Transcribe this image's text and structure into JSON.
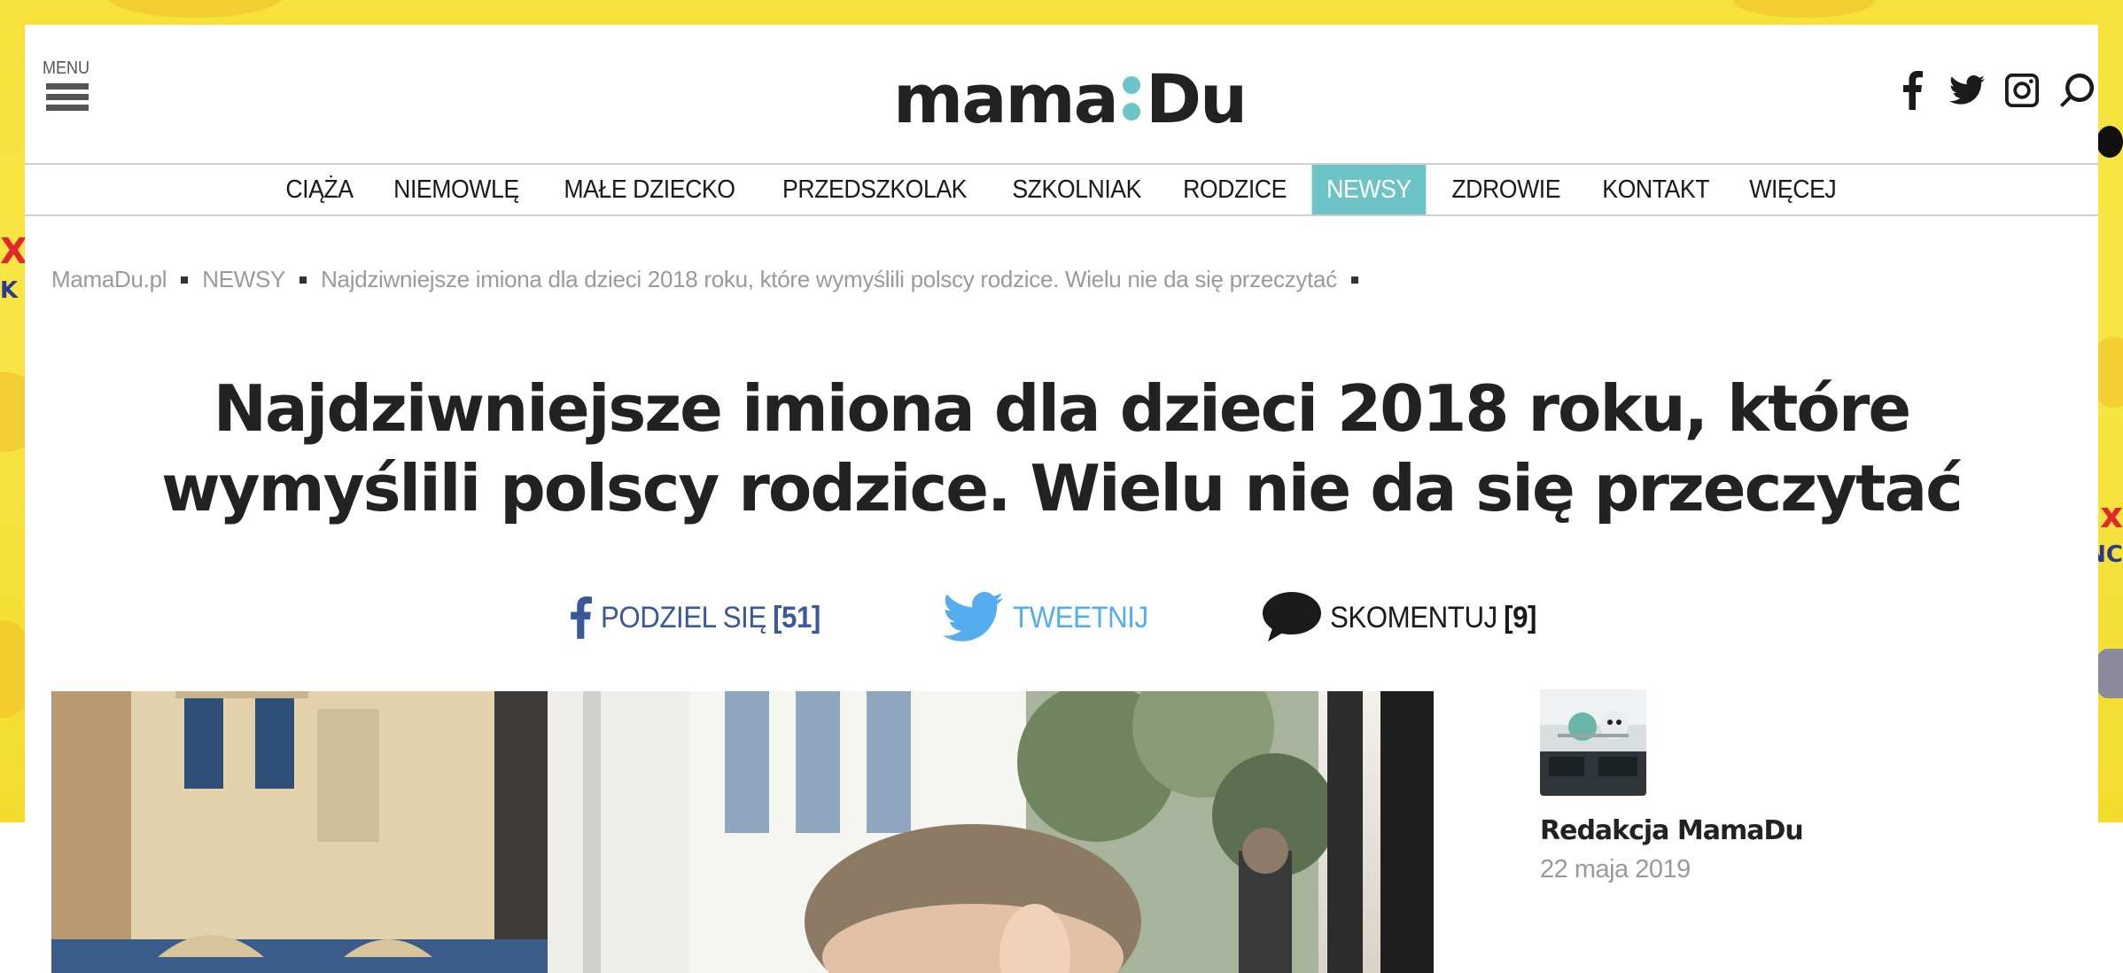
{
  "header": {
    "menu_label": "MENU",
    "logo_left": "mama",
    "logo_right": "Du"
  },
  "nav": {
    "items": [
      {
        "label": "CIĄŻA",
        "active": false
      },
      {
        "label": "NIEMOWLĘ",
        "active": false
      },
      {
        "label": "MAŁE DZIECKO",
        "active": false
      },
      {
        "label": "PRZEDSZKOLAK",
        "active": false
      },
      {
        "label": "SZKOLNIAK",
        "active": false
      },
      {
        "label": "RODZICE",
        "active": false
      },
      {
        "label": "NEWSY",
        "active": true
      },
      {
        "label": "ZDROWIE",
        "active": false
      },
      {
        "label": "KONTAKT",
        "active": false
      },
      {
        "label": "WIĘCEJ",
        "active": false
      }
    ]
  },
  "breadcrumb": {
    "home": "MamaDu.pl",
    "section": "NEWSY",
    "current": "Najdziwniejsze imiona dla dzieci 2018 roku, które wymyślili polscy rodzice. Wielu nie da się przeczytać"
  },
  "article": {
    "title_line1": "Najdziwniejsze imiona dla dzieci 2018 roku, które",
    "title_line2": "wymyślili polscy rodzice. Wielu nie da się przeczytać"
  },
  "share": {
    "facebook_label": "PODZIEL SIĘ",
    "facebook_count": "[51]",
    "twitter_label": "TWEETNIJ",
    "comment_label": "SKOMENTUJ",
    "comment_count": "[9]"
  },
  "author": {
    "name": "Redakcja MamaDu",
    "date": "22 maja 2019"
  },
  "colors": {
    "accent": "#6cc4c6",
    "facebook": "#3b5998",
    "twitter": "#55acee",
    "background_ad": "#f6e23a"
  },
  "icons": [
    "menu-icon",
    "facebook-icon",
    "twitter-icon",
    "instagram-icon",
    "search-icon",
    "comment-icon"
  ]
}
